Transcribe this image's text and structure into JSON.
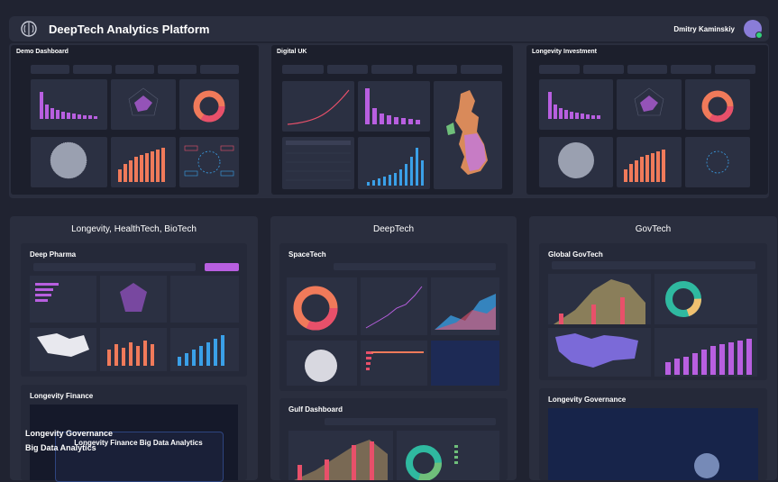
{
  "app": {
    "title": "DeepTech Analytics Platform",
    "user_name": "Dmitry Kaminskiy"
  },
  "top_dashboards": [
    {
      "title": "Demo Dashboard"
    },
    {
      "title": "Digital UK"
    },
    {
      "title": "Longevity Investment"
    }
  ],
  "sections": [
    {
      "title": "Longevity, HealthTech, BioTech",
      "cards": [
        {
          "title": "Deep Pharma"
        },
        {
          "title": "Longevity Finance"
        }
      ]
    },
    {
      "title": "DeepTech",
      "cards": [
        {
          "title": "SpaceTech"
        },
        {
          "title": "Gulf Dashboard"
        }
      ]
    },
    {
      "title": "GovTech",
      "cards": [
        {
          "title": "Global GovTech"
        },
        {
          "title": "Longevity Governance"
        }
      ]
    }
  ],
  "promos": {
    "finance": "Longevity Finance Big Data Analytics",
    "governance_line1": "Longevity Governance",
    "governance_line2": "Big Data Analytics"
  },
  "colors": {
    "accent": "#b85fe0",
    "orange": "#f07a5a",
    "blue": "#3aa0e8",
    "teal": "#2fb9a0"
  }
}
